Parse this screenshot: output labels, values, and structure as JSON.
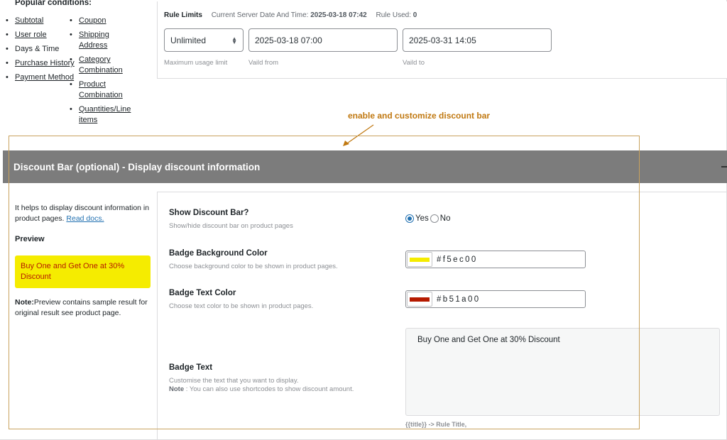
{
  "popular_conditions": {
    "title": "Popular conditions:",
    "col1": [
      "Subtotal",
      "User role",
      "Days & Time",
      "Purchase History",
      "Payment Method"
    ],
    "col2": [
      "Coupon",
      "Shipping Address",
      "Category Combination",
      "Product Combination",
      "Quantities/Line items"
    ]
  },
  "rule_limits": {
    "label": "Rule Limits",
    "server_time_label": "Current Server Date And Time:",
    "server_time_value": "2025-03-18 07:42",
    "rule_used_label": "Rule Used:",
    "rule_used_value": "0",
    "usage_limit": "Unlimited",
    "usage_limit_caption": "Maximum usage limit",
    "valid_from": "2025-03-18 07:00",
    "valid_from_caption": "Vaild from",
    "valid_to": "2025-03-31 14:05",
    "valid_to_caption": "Vaild to"
  },
  "annotation": "enable and customize discount bar",
  "section": {
    "title": "Discount Bar (optional) - Display discount information"
  },
  "preview_panel": {
    "help_text": "It helps to display discount information in product pages.",
    "read_docs": "Read docs.",
    "preview_label": "Preview",
    "preview_text": "Buy One and Get One at 30% Discount",
    "note_label": "Note:",
    "note_text": "Preview contains sample result for original result see product page."
  },
  "settings": {
    "show_bar": {
      "title": "Show Discount Bar?",
      "desc": "Show/hide discount bar on product pages",
      "yes": "Yes",
      "no": "No",
      "selected": "Yes"
    },
    "badge_bg": {
      "title": "Badge Background Color",
      "desc": "Choose background color to be shown in product pages.",
      "value": "#f5ec00"
    },
    "badge_text_color": {
      "title": "Badge Text Color",
      "desc": "Choose text color to be shown in product pages.",
      "value": "#b51a00"
    },
    "badge_text": {
      "title": "Badge Text",
      "desc": "Customise the text that you want to display.",
      "note_label": "Note",
      "note": " : You can also use shortcodes to show discount amount.",
      "value": "Buy One and Get One at 30% Discount",
      "shortcode_hint": "{{title}} -> Rule Title,"
    }
  },
  "colors": {
    "section_header_bg": "#7c7c7c",
    "annotation": "#c07810",
    "link": "#2271b1"
  }
}
